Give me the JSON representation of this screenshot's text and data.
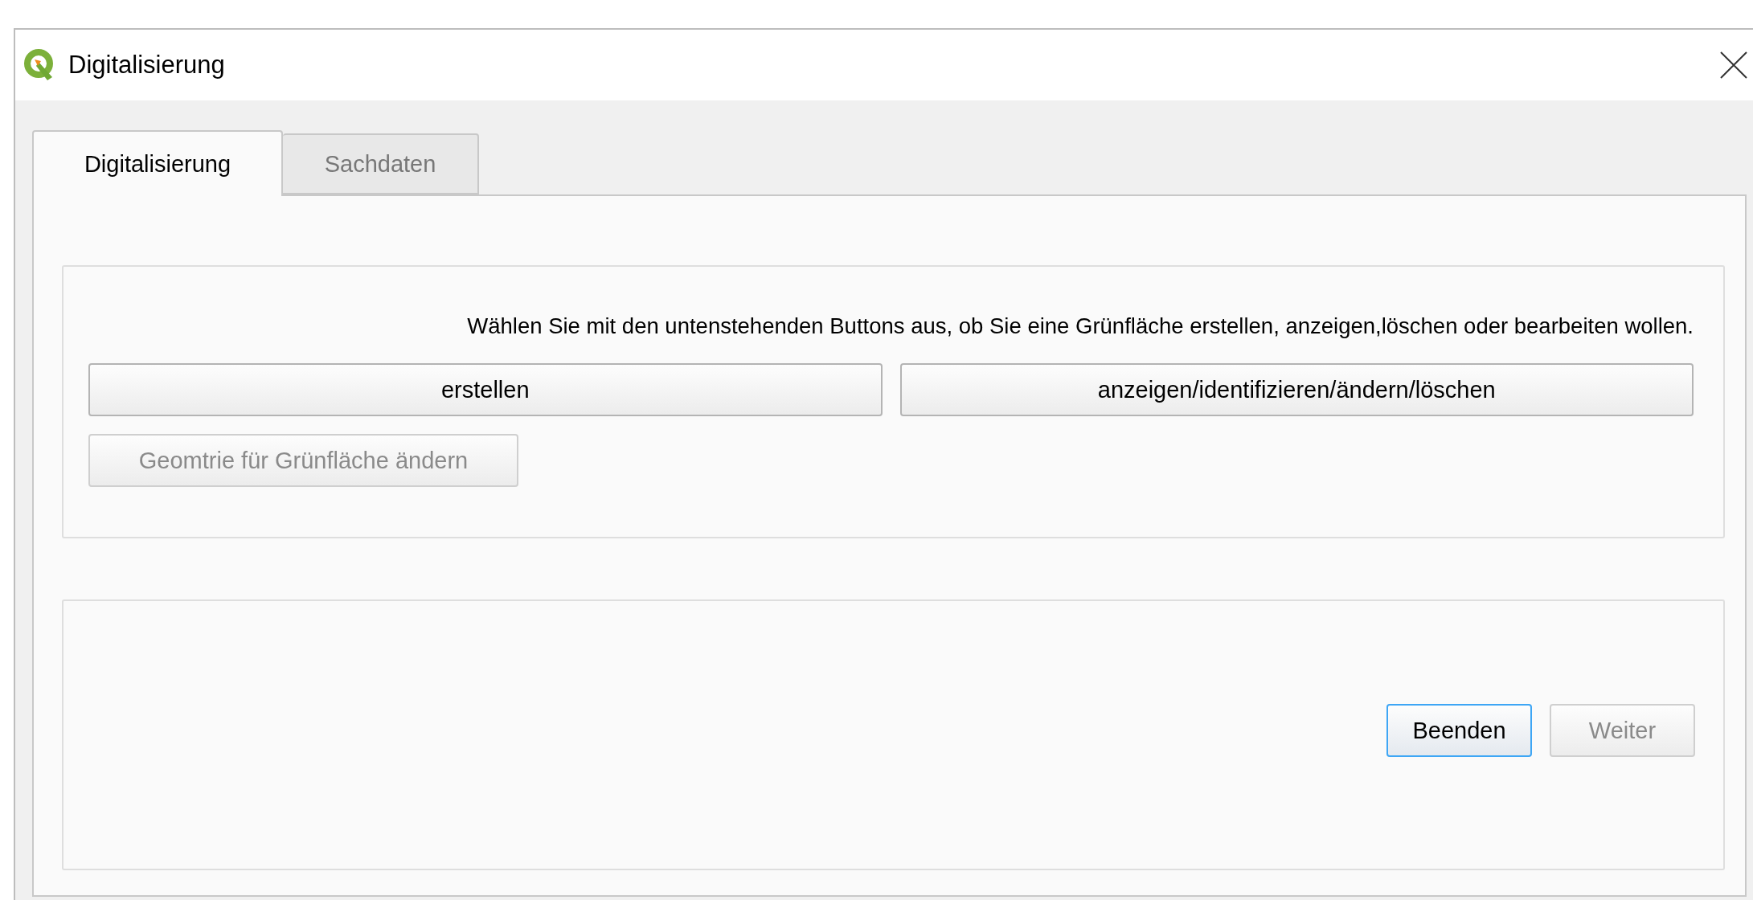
{
  "window": {
    "title": "Digitalisierung"
  },
  "tabs": [
    {
      "label": "Digitalisierung",
      "selected": true
    },
    {
      "label": "Sachdaten",
      "selected": false
    }
  ],
  "instructions": "Wählen Sie mit den untenstehenden Buttons aus, ob Sie eine Grünfläche erstellen, anzeigen,löschen oder bearbeiten wollen.",
  "action_buttons": [
    {
      "label": "erstellen",
      "disabled": false
    },
    {
      "label": "anzeigen/identifizieren/ändern/löschen",
      "disabled": false
    }
  ],
  "geometry_button": {
    "label": "Geomtrie für Grünfläche ändern",
    "disabled": true
  },
  "footer_buttons": [
    {
      "label": "Beenden",
      "disabled": false,
      "focused": true
    },
    {
      "label": "Weiter",
      "disabled": true,
      "focused": false
    }
  ]
}
